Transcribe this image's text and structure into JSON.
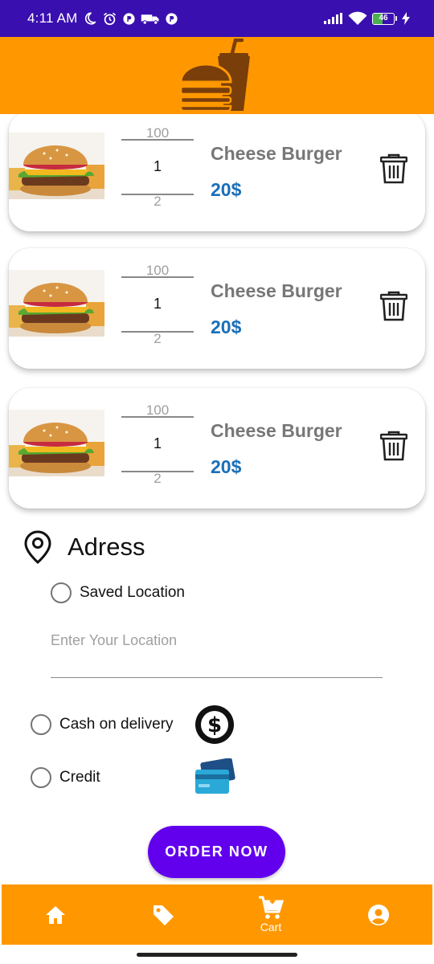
{
  "status_bar": {
    "time": "4:11 AM",
    "battery_level": "46",
    "battery_fraction": 0.46,
    "left_icons": [
      "moon-icon",
      "alarm-icon",
      "app-notification-icon",
      "delivery-truck-icon",
      "app-notification-icon"
    ],
    "right_icons": [
      "signal-icon",
      "wifi-icon",
      "battery-icon",
      "charging-icon"
    ]
  },
  "app_bar": {
    "logo_icon": "burger-drink-logo"
  },
  "cart": {
    "items": [
      {
        "qty_prev": "100",
        "qty": "1",
        "qty_next": "2",
        "name": "Cheese Burger",
        "price": "20$"
      },
      {
        "qty_prev": "100",
        "qty": "1",
        "qty_next": "2",
        "name": "Cheese Burger",
        "price": "20$"
      },
      {
        "qty_prev": "100",
        "qty": "1",
        "qty_next": "2",
        "name": "Cheese Burger",
        "price": "20$"
      }
    ]
  },
  "address": {
    "title": "Adress",
    "saved_location_label": "Saved Location",
    "location_placeholder": "Enter Your Location"
  },
  "payment": {
    "cash_label": "Cash on delivery",
    "credit_label": "Credit"
  },
  "order_button": "ORDER NOW",
  "bottom_nav": {
    "items": [
      {
        "icon": "home-icon",
        "label": ""
      },
      {
        "icon": "tag-icon",
        "label": ""
      },
      {
        "icon": "cart-icon",
        "label": "Cart"
      },
      {
        "icon": "account-icon",
        "label": ""
      }
    ]
  },
  "colors": {
    "status_bar": "#3a0fb0",
    "app_bar": "#ff9800",
    "order_button": "#6200ee",
    "price": "#1a6fb8",
    "item_name": "#777777"
  }
}
